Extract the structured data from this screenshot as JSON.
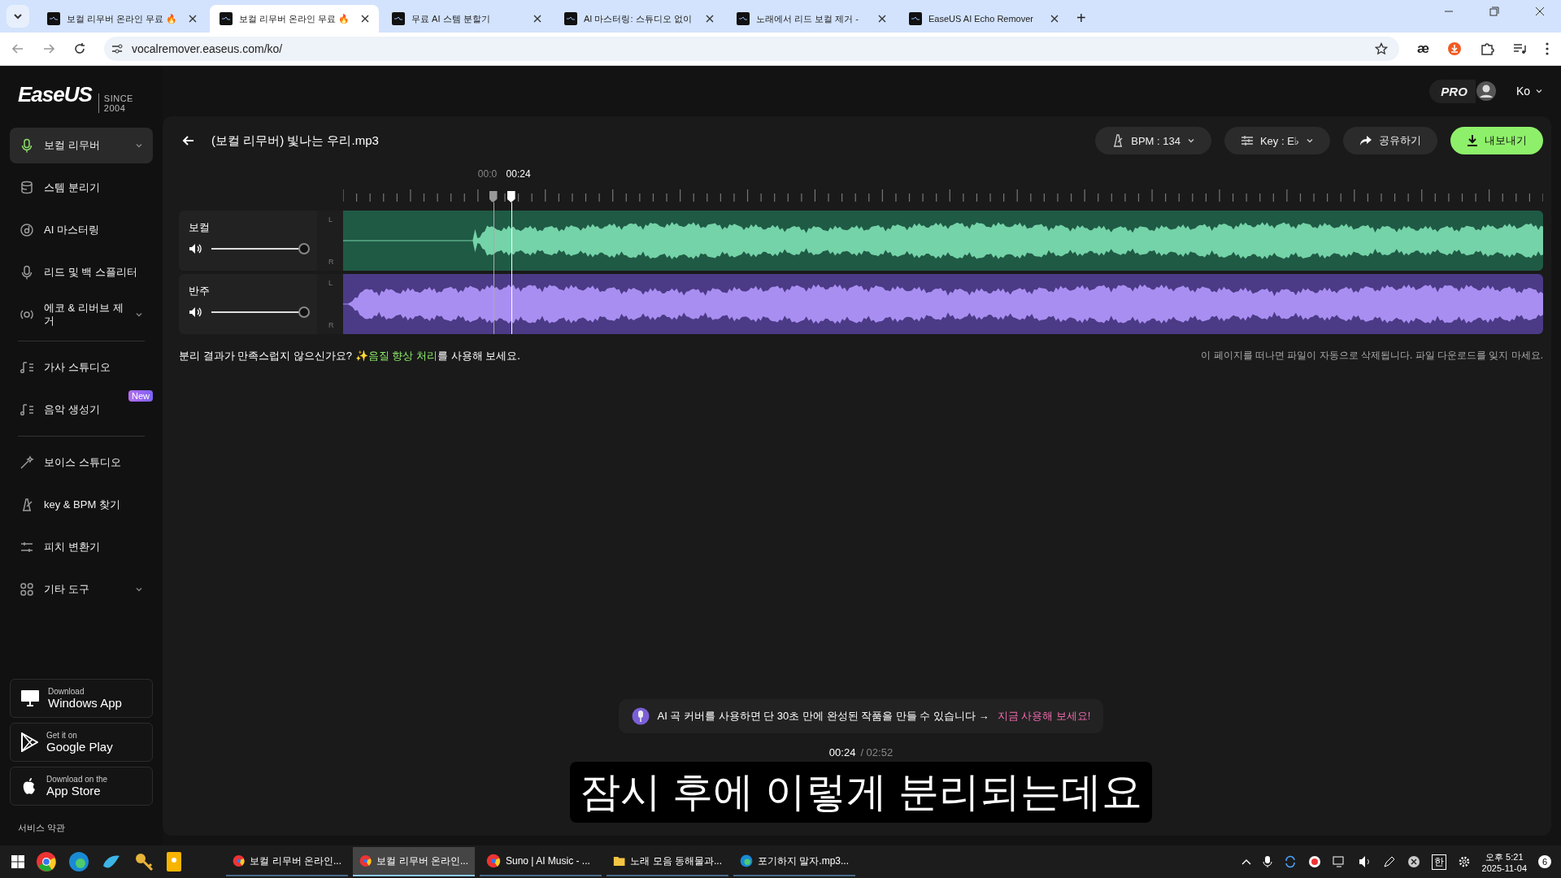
{
  "browser": {
    "tabs": [
      {
        "title": "보컬 리무버 온라인 무료 🔥",
        "selected": false
      },
      {
        "title": "보컬 리무버 온라인 무료 🔥",
        "selected": true
      },
      {
        "title": "무료 AI 스템 분할기",
        "selected": false
      },
      {
        "title": "AI 마스터링: 스튜디오 없이",
        "selected": false
      },
      {
        "title": "노래에서 리드 보컬 제거 -",
        "selected": false
      },
      {
        "title": "EaseUS AI Echo Remover",
        "selected": false
      }
    ],
    "new_tab": "+",
    "address": "vocalremover.easeus.com/ko/",
    "ext_text": "æ"
  },
  "header": {
    "logo": "EaseUS",
    "since": "SINCE 2004",
    "pro": "PRO",
    "language": "Ko"
  },
  "sidebar": {
    "sections": [
      [
        {
          "label": "보컬 리무버",
          "selected": true,
          "expandable": true
        },
        {
          "label": "스템 분리기",
          "selected": false,
          "expandable": false
        },
        {
          "label": "AI 마스터링",
          "selected": false,
          "expandable": false
        },
        {
          "label": "리드 및 백 스플리터",
          "selected": false,
          "expandable": false
        },
        {
          "label": "에코 & 리버브 제거",
          "selected": false,
          "expandable": true
        }
      ],
      [
        {
          "label": "가사 스튜디오",
          "selected": false,
          "expandable": false
        },
        {
          "label": "음악 생성기",
          "selected": false,
          "expandable": false,
          "badge": "New"
        }
      ],
      [
        {
          "label": "보이스 스튜디오",
          "selected": false,
          "expandable": false
        },
        {
          "label": "key & BPM 찾기",
          "selected": false,
          "expandable": false
        },
        {
          "label": "피치 변환기",
          "selected": false,
          "expandable": false
        },
        {
          "label": "기타 도구",
          "selected": false,
          "expandable": true
        }
      ]
    ],
    "stores": [
      {
        "kind": "windows",
        "small": "Download",
        "big": "Windows App"
      },
      {
        "kind": "google",
        "small": "Get it on",
        "big": "Google Play"
      },
      {
        "kind": "apple",
        "small": "Download on the",
        "big": "App Store"
      }
    ],
    "footer_link": "서비스 약관"
  },
  "toolbar": {
    "file_name": "(보컬 리무버) 빛나는 우리.mp3",
    "bpm": "BPM : 134",
    "key": "Key : E♭",
    "share": "공유하기",
    "export": "내보내기"
  },
  "timeline": {
    "marker_label": "00:0",
    "playhead_label": "00:24"
  },
  "tracks": [
    {
      "name": "보컬",
      "kind": "vocal",
      "level": 0.97,
      "left": "L",
      "right": "R"
    },
    {
      "name": "반주",
      "kind": "accompaniment",
      "level": 0.97,
      "left": "L",
      "right": "R"
    }
  ],
  "notice": {
    "prefix": "분리 결과가 만족스럽지 않으신가요? ✨",
    "link": "음질 향상 처리",
    "suffix": "를 사용해 보세요.",
    "right": "이 페이지를 떠나면 파일이 자동으로 삭제됩니다. 파일 다운로드를 잊지 마세요."
  },
  "promo": {
    "text": "AI 곡 커버를 사용하면 단 30초 만에 완성된 작품을 만들 수 있습니다 →",
    "link": "지금 사용해 보세요!"
  },
  "player": {
    "current": "00:24",
    "total": "/ 02:52"
  },
  "subtitle": "잠시 후에 이렇게 분리되는데요",
  "taskbar": {
    "apps": [
      {
        "label": "보컬 리무버 온라인...",
        "kind": "chrome",
        "selected": false
      },
      {
        "label": "보컬 리무버 온라인...",
        "kind": "chrome",
        "selected": true
      },
      {
        "label": "Suno | AI Music - ...",
        "kind": "chrome",
        "selected": false
      },
      {
        "label": "노래 모음 동해물과...",
        "kind": "folder",
        "selected": false
      },
      {
        "label": "포기하지 말자.mp3...",
        "kind": "edge",
        "selected": false
      }
    ],
    "ime": "한",
    "time": "오후 5:21",
    "date": "2025-11-04",
    "notifications": "6"
  }
}
